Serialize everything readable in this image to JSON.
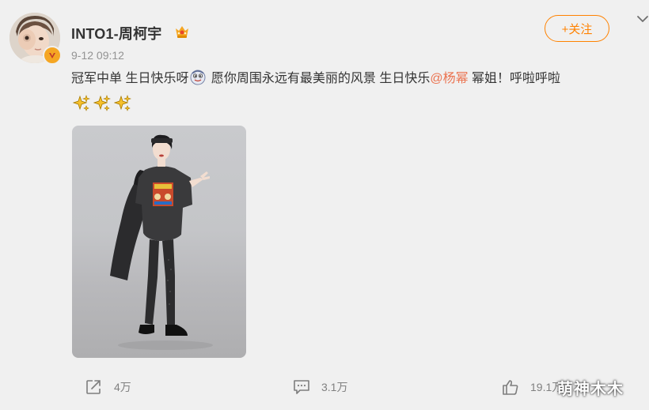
{
  "post": {
    "author": {
      "name": "INTO1-周柯宇",
      "verified_badge_color": "#f5a623",
      "crown_icon": "vip-crown-icon"
    },
    "timestamp": "9-12 09:12",
    "follow_label": "+关注",
    "follow_color": "#ff8200",
    "text_part1": "冠军中单 生日快乐呀",
    "text_part2": "愿你周围永远有最美丽的风景 生日快乐",
    "mention": "@杨幂",
    "text_part3": " 幂姐！呼啦呼啦",
    "sparkle_count": 3
  },
  "footer": {
    "repost_count": "4万",
    "comment_count": "3.1万",
    "like_count": "19.1万"
  },
  "watermark": "萌神木木"
}
